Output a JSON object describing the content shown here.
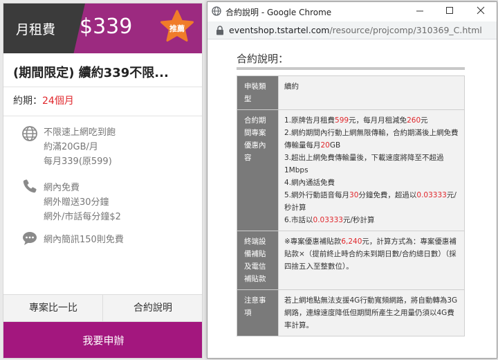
{
  "plan_card": {
    "monthly_label": "月租費",
    "price": "$339",
    "badge": "推薦",
    "title": "(期間限定) 續約339不限...",
    "term_label": "約期：",
    "term_value": "24個月",
    "features": [
      {
        "icon": "globe-icon",
        "lines": [
          "不限速上網吃到飽",
          "約滿20GB/月",
          "每月339(原599)"
        ]
      },
      {
        "icon": "phone-icon",
        "lines": [
          "網內免費",
          "網外贈送30分鐘",
          "網外/市話每分鐘$2"
        ]
      },
      {
        "icon": "chat-bubble-icon",
        "lines": [
          "網內簡訊150則免費"
        ]
      }
    ],
    "compare_button": "專案比一比",
    "contract_button": "合約說明",
    "apply_button": "我要申辦",
    "colors": {
      "brand": "#9c2a80",
      "apply": "#a3177e",
      "dark": "#3b3b3b",
      "star": "#f07c2a",
      "highlight": "#e0262b"
    }
  },
  "popup": {
    "window_title": "合約說明 - Google Chrome",
    "url_host": "eventshop.tstartel.com",
    "url_path": "/resource/projcomp/310369_C.html",
    "heading": "合約說明：",
    "rows": [
      {
        "label": "申裝類型",
        "segments": [
          {
            "text": "續約"
          }
        ]
      },
      {
        "label": "合約期間專案優惠內容",
        "segments": [
          {
            "text": "1.原牌告月租費"
          },
          {
            "text": "599",
            "hl": true
          },
          {
            "text": "元，每月月租減免"
          },
          {
            "text": "260",
            "hl": true
          },
          {
            "text": "元"
          },
          {
            "br": true
          },
          {
            "text": "2.網約期間內行動上網無限傳輸，合約期滿後上網免費傳輸量每月"
          },
          {
            "text": "20",
            "hl": true
          },
          {
            "text": "GB"
          },
          {
            "br": true
          },
          {
            "text": "3.超出上網免費傳輸量後，下載速度將降至不超過1Mbps"
          },
          {
            "br": true
          },
          {
            "text": "4.網內通話免費"
          },
          {
            "br": true
          },
          {
            "text": "5.網外行動語音每月"
          },
          {
            "text": "30",
            "hl": true
          },
          {
            "text": "分鐘免費，超過以"
          },
          {
            "text": "0.03333",
            "hl": true
          },
          {
            "text": "元/秒計算"
          },
          {
            "br": true
          },
          {
            "text": "6.市話以"
          },
          {
            "text": "0.03333",
            "hl": true
          },
          {
            "text": "元/秒計算"
          }
        ]
      },
      {
        "label": "終端設備補貼及電信補貼款",
        "segments": [
          {
            "text": "※專案優惠補貼款"
          },
          {
            "text": "6,240",
            "hl": true
          },
          {
            "text": "元，計算方式為：專案優惠補貼款×（提前終止時合約未到期日數/合約總日數）（採四捨五入至整數位）。"
          }
        ]
      },
      {
        "label": "注意事項",
        "segments": [
          {
            "text": "若上網地點無法支援4G行動寬頻網路，將自動轉為3G網路，連線速度降低但期間所產生之用量仍須以4G費率計算。"
          }
        ]
      }
    ]
  }
}
